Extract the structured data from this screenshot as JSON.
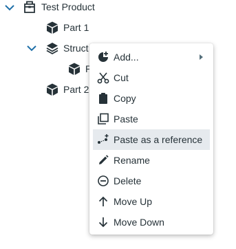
{
  "tree": {
    "root": {
      "label": "Test Product",
      "icon": "product-icon",
      "expanded": true
    },
    "items": [
      {
        "label": "Part 1",
        "icon": "part-cube-icon"
      },
      {
        "label": "Struct",
        "icon": "assembly-layers-icon",
        "expanded": true
      },
      {
        "label": "P",
        "icon": "part-cube-icon"
      },
      {
        "label": "Part 2",
        "icon": "part-cube-icon"
      }
    ]
  },
  "context_menu": {
    "items": [
      {
        "label": "Add...",
        "icon": "add-shape-icon",
        "has_submenu": true
      },
      {
        "label": "Cut",
        "icon": "scissors-icon"
      },
      {
        "label": "Copy",
        "icon": "clipboard-icon"
      },
      {
        "label": "Paste",
        "icon": "paste-icon"
      },
      {
        "label": "Paste as a reference",
        "icon": "paste-reference-icon",
        "highlighted": true
      },
      {
        "label": "Rename",
        "icon": "pencil-icon"
      },
      {
        "label": "Delete",
        "icon": "minus-circle-icon"
      },
      {
        "label": "Move Up",
        "icon": "arrow-up-icon"
      },
      {
        "label": "Move Down",
        "icon": "arrow-down-icon"
      }
    ]
  },
  "colors": {
    "chevron": "#1e6fa8",
    "icon": "#263238",
    "highlight": "#e6eaee"
  }
}
